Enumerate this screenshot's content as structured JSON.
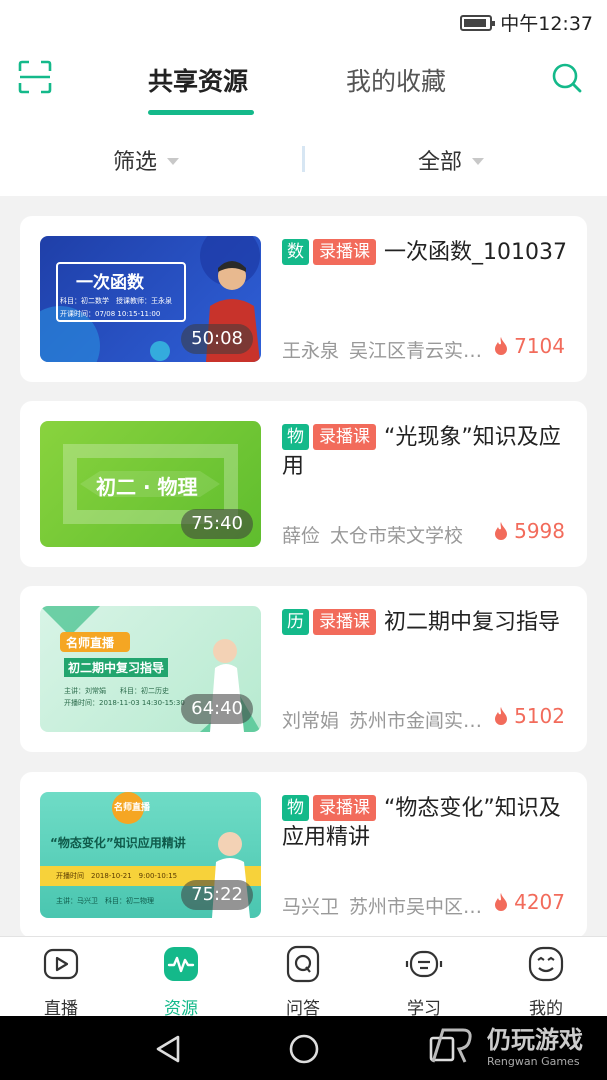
{
  "status_bar": {
    "time": "中午12:37"
  },
  "header": {
    "tabs": [
      "共享资源",
      "我的收藏"
    ],
    "active_tab": 0
  },
  "filters": {
    "left": "筛选",
    "right": "全部"
  },
  "courses": [
    {
      "subject": "数",
      "type": "录播课",
      "title": "一次函数_101037",
      "teacher": "王永泉",
      "school": "吴江区青云实…",
      "views": "7104",
      "duration": "50:08",
      "thumb_title": "一次函数",
      "thumb_line1": "科目：初二数学　授课教师：王永泉",
      "thumb_line2": "开课时间：07/08 10:15-11:00"
    },
    {
      "subject": "物",
      "type": "录播课",
      "title": "“光现象”知识及应用",
      "teacher": "薛俭",
      "school": "太仓市荣文学校",
      "views": "5998",
      "duration": "75:40",
      "thumb_title": "初二 · 物理"
    },
    {
      "subject": "历",
      "type": "录播课",
      "title": "初二期中复习指导",
      "teacher": "刘常娟",
      "school": "苏州市金阊实…",
      "views": "5102",
      "duration": "64:40",
      "thumb_banner": "名师直播",
      "thumb_title": "初二期中复习指导",
      "thumb_line1": "主讲：刘常娟　　科目：初二历史",
      "thumb_line2": "开播时间：2018-11-03 14:30-15:30"
    },
    {
      "subject": "物",
      "type": "录播课",
      "title": "“物态变化”知识及应用精讲",
      "teacher": "马兴卫",
      "school": "苏州市吴中区…",
      "views": "4207",
      "duration": "75:22",
      "thumb_banner": "名师直播",
      "thumb_title": "“物态变化”知识应用精讲",
      "thumb_line1": "开播时间　2018-10-21　9:00-10:15",
      "thumb_line2": "主讲：马兴卫　科目：初二物理"
    }
  ],
  "bottom_nav": [
    {
      "label": "直播",
      "icon": "video-icon"
    },
    {
      "label": "资源",
      "icon": "waveform-icon"
    },
    {
      "label": "问答",
      "icon": "q-icon"
    },
    {
      "label": "学习",
      "icon": "robot-icon"
    },
    {
      "label": "我的",
      "icon": "smiley-icon"
    }
  ],
  "active_nav": 1,
  "watermark": {
    "cn": "仍玩游戏",
    "en": "Rengwan Games"
  },
  "colors": {
    "accent": "#14b98a",
    "tag_red": "#f26b5b",
    "hot": "#f26b5b"
  }
}
